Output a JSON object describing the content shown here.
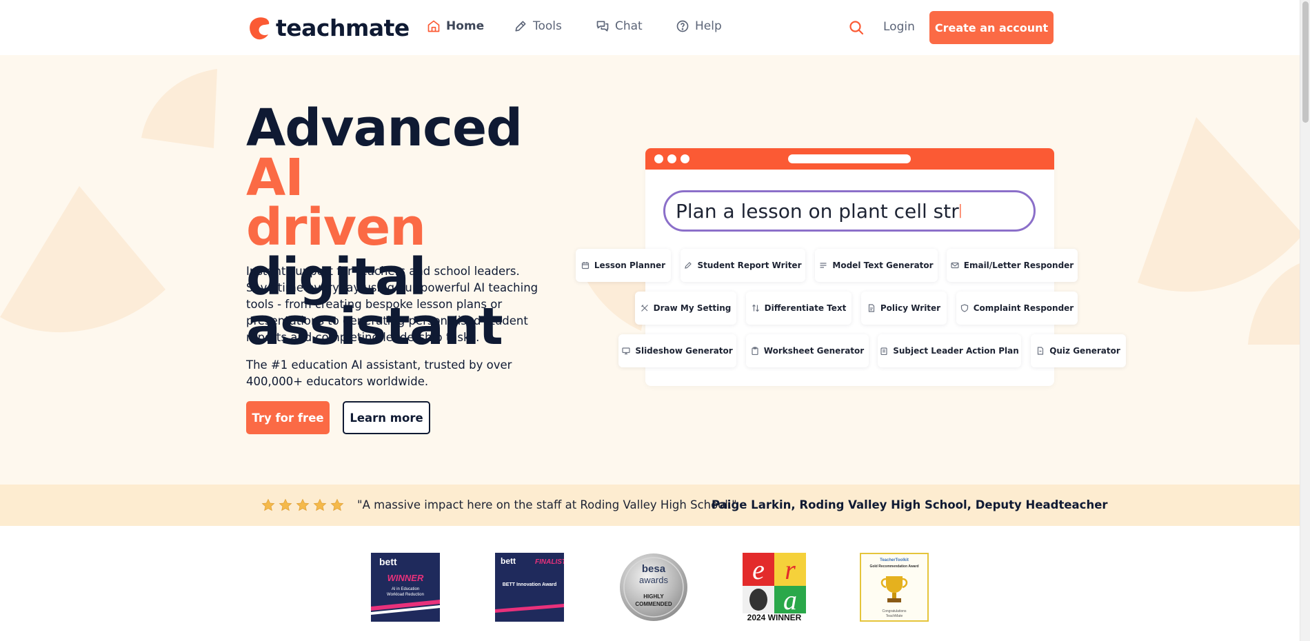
{
  "header": {
    "brand": "teachmate",
    "nav": [
      {
        "label": "Home",
        "icon": "home-icon",
        "active": true
      },
      {
        "label": "Tools",
        "icon": "pencil-tool-icon",
        "active": false
      },
      {
        "label": "Chat",
        "icon": "chat-bubbles-icon",
        "active": false
      },
      {
        "label": "Help",
        "icon": "help-circle-icon",
        "active": false
      }
    ],
    "login_label": "Login",
    "cta_label": "Create an account"
  },
  "hero": {
    "headline_1": "Advanced ",
    "headline_accent_1": "AI",
    "headline_accent_2": "driven",
    "headline_2": " digital",
    "headline_3": "assistant",
    "description": "Instant support for teachers and school leaders. Save time everyday using our powerful AI teaching tools - from creating bespoke lesson plans or presentations to generating personalised student reports and completing leadership tasks.",
    "trust_text": "The #1 education AI assistant, trusted by over 400,000+ educators worldwide.",
    "try_label": "Try for free",
    "learn_label": "Learn more"
  },
  "mock": {
    "prompt_text": "Plan a lesson on plant cell str",
    "tools": [
      {
        "label": "Lesson Planner",
        "icon": "calendar-icon"
      },
      {
        "label": "Student Report Writer",
        "icon": "pen-icon"
      },
      {
        "label": "Model Text Generator",
        "icon": "text-lines-icon"
      },
      {
        "label": "Email/Letter Responder",
        "icon": "envelope-icon"
      },
      {
        "label": "Draw My Setting",
        "icon": "pen-ruler-icon"
      },
      {
        "label": "Differentiate Text",
        "icon": "swap-icon"
      },
      {
        "label": "Policy Writer",
        "icon": "document-icon"
      },
      {
        "label": "Complaint Responder",
        "icon": "shield-heart-icon"
      },
      {
        "label": "Slideshow Generator",
        "icon": "monitor-icon"
      },
      {
        "label": "Worksheet Generator",
        "icon": "clipboard-icon"
      },
      {
        "label": "Subject Leader Action Plan",
        "icon": "clipboard-list-icon"
      },
      {
        "label": "Quiz Generator",
        "icon": "quiz-document-icon"
      }
    ]
  },
  "testimonial": {
    "rating": 5,
    "quote": "\"A massive impact here on the staff at Roding Valley High School.\"",
    "author": "Paige Larkin, Roding Valley High School, Deputy Headteacher"
  },
  "awards": [
    {
      "name": "bett-winner-badge",
      "lines": [
        "bett",
        "WINNER",
        "AI in Education",
        "Workload Reduction"
      ]
    },
    {
      "name": "bett-finalist-badge",
      "lines": [
        "bett",
        "FINALIST",
        "BETT Innovation Award"
      ]
    },
    {
      "name": "besa-awards-badge",
      "lines": [
        "besa",
        "awards",
        "HIGHLY",
        "COMMENDED"
      ]
    },
    {
      "name": "era-winner-badge",
      "lines": [
        "e",
        "r",
        "a",
        "2024 WINNER"
      ]
    },
    {
      "name": "teachertoolkit-award-badge",
      "lines": [
        "TeacherToolkit",
        "Gold Recommendation Award",
        "Congratulations TeachMate"
      ]
    }
  ],
  "colors": {
    "accent": "#fb6a45",
    "navy": "#0f1a33",
    "hero_bg": "#fef8ee",
    "strip_bg": "#fdecd0",
    "prompt_border": "#8b6fc9"
  }
}
